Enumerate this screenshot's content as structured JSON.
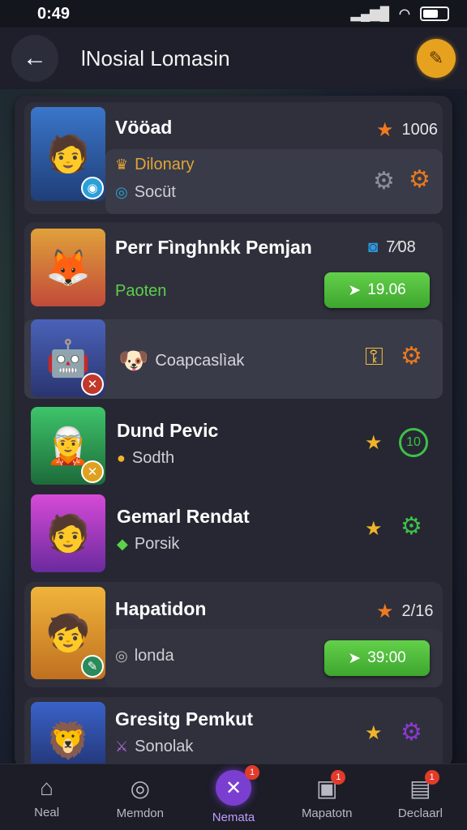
{
  "status_bar": {
    "time": "0:49"
  },
  "header": {
    "title": "lNosial Lomasin"
  },
  "items": [
    {
      "name": "Vööad",
      "sub1": "Dilonary",
      "sub2": "Socüt",
      "rating": "1006"
    },
    {
      "name": "Perr Fìnghnkk Pemjan",
      "sub": "Paoten",
      "rating": "7⁄08",
      "button": "19.06"
    },
    {
      "name": "",
      "sub": "Coapcaslìak"
    },
    {
      "name": "Dund Pevic",
      "sub": "Sodth",
      "level": "10"
    },
    {
      "name": "Gemarl Rendat",
      "sub": "Porsik"
    },
    {
      "name": "Hapatidon",
      "sub": "londa",
      "rating": "2/16",
      "button": "39:00"
    },
    {
      "name": "Gresitg Pemkut",
      "sub": "Sonolak"
    }
  ],
  "bottom_nav": [
    {
      "label": "Neal",
      "icon": "home-icon"
    },
    {
      "label": "Memdon",
      "icon": "compass-icon",
      "badge": ""
    },
    {
      "label": "Nemata",
      "icon": "crossed-swords-icon",
      "badge": "1",
      "active": true
    },
    {
      "label": "Mapatotn",
      "icon": "map-icon",
      "badge": "1"
    },
    {
      "label": "Declaarl",
      "icon": "card-icon",
      "badge": "1"
    }
  ],
  "colors": {
    "accent": "#7a3fd0",
    "button_green": "#4bbd37",
    "star": "#f0b429",
    "panel": "#262732"
  }
}
